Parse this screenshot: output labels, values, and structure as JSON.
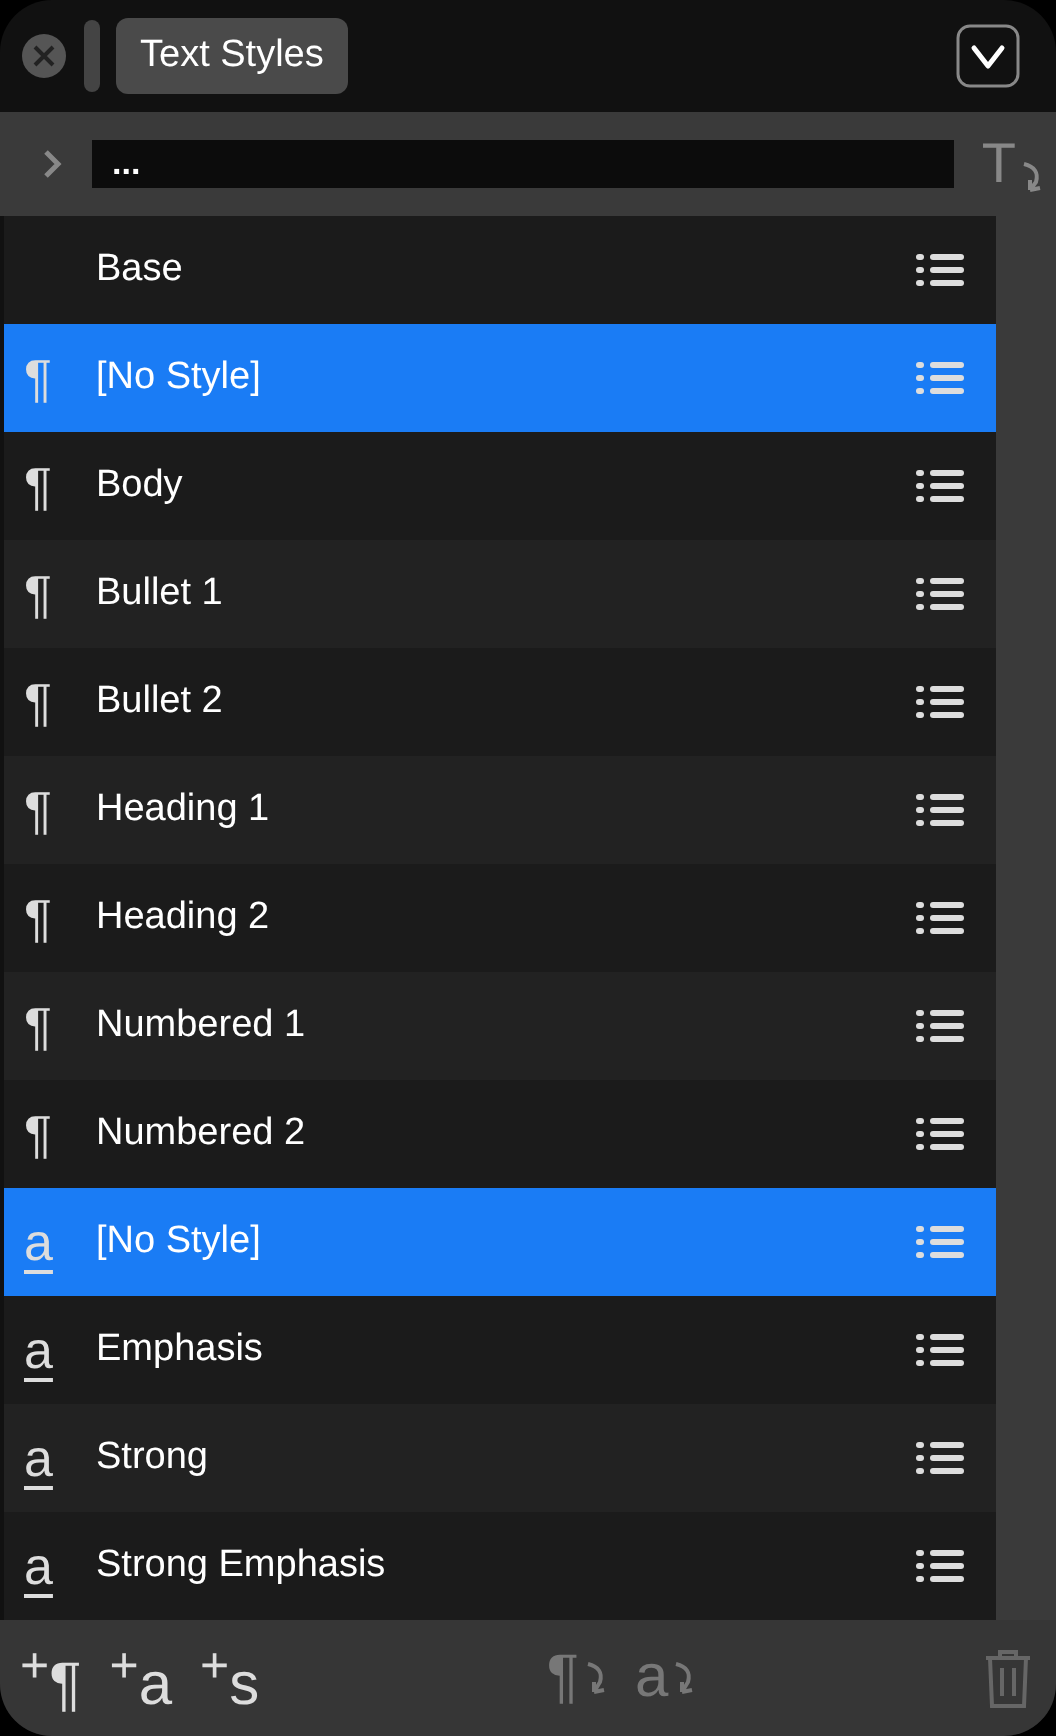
{
  "window": {
    "title": "Text Styles"
  },
  "path_bar": {
    "value": "...",
    "apply_glyph": "T"
  },
  "styles": [
    {
      "kind": "base",
      "name": "Base",
      "selected": false
    },
    {
      "kind": "paragraph",
      "glyph": "¶",
      "name": "[No Style]",
      "selected": true
    },
    {
      "kind": "paragraph",
      "glyph": "¶",
      "name": "Body",
      "selected": false
    },
    {
      "kind": "paragraph",
      "glyph": "¶",
      "name": "Bullet 1",
      "selected": false
    },
    {
      "kind": "paragraph",
      "glyph": "¶",
      "name": "Bullet 2",
      "selected": false
    },
    {
      "kind": "paragraph",
      "glyph": "¶",
      "name": "Heading 1",
      "selected": false
    },
    {
      "kind": "paragraph",
      "glyph": "¶",
      "name": "Heading 2",
      "selected": false
    },
    {
      "kind": "paragraph",
      "glyph": "¶",
      "name": "Numbered 1",
      "selected": false
    },
    {
      "kind": "paragraph",
      "glyph": "¶",
      "name": "Numbered 2",
      "selected": false
    },
    {
      "kind": "character",
      "glyph": "a",
      "name": "[No Style]",
      "selected": true
    },
    {
      "kind": "character",
      "glyph": "a",
      "name": "Emphasis",
      "selected": false
    },
    {
      "kind": "character",
      "glyph": "a",
      "name": "Strong",
      "selected": false
    },
    {
      "kind": "character",
      "glyph": "a",
      "name": "Strong Emphasis",
      "selected": false
    }
  ],
  "footer": [
    {
      "kind": "add",
      "label": "$^{+}$¶",
      "disabled": false
    },
    {
      "kind": "add",
      "label": "$^{+}$a",
      "disabled": false
    },
    {
      "kind": "add",
      "label": "$^{+}$s",
      "disabled": false
    },
    {
      "kind": "apply",
      "label": "¶",
      "disabled": true
    },
    {
      "kind": "apply",
      "label": "a",
      "disabled": true
    }
  ]
}
